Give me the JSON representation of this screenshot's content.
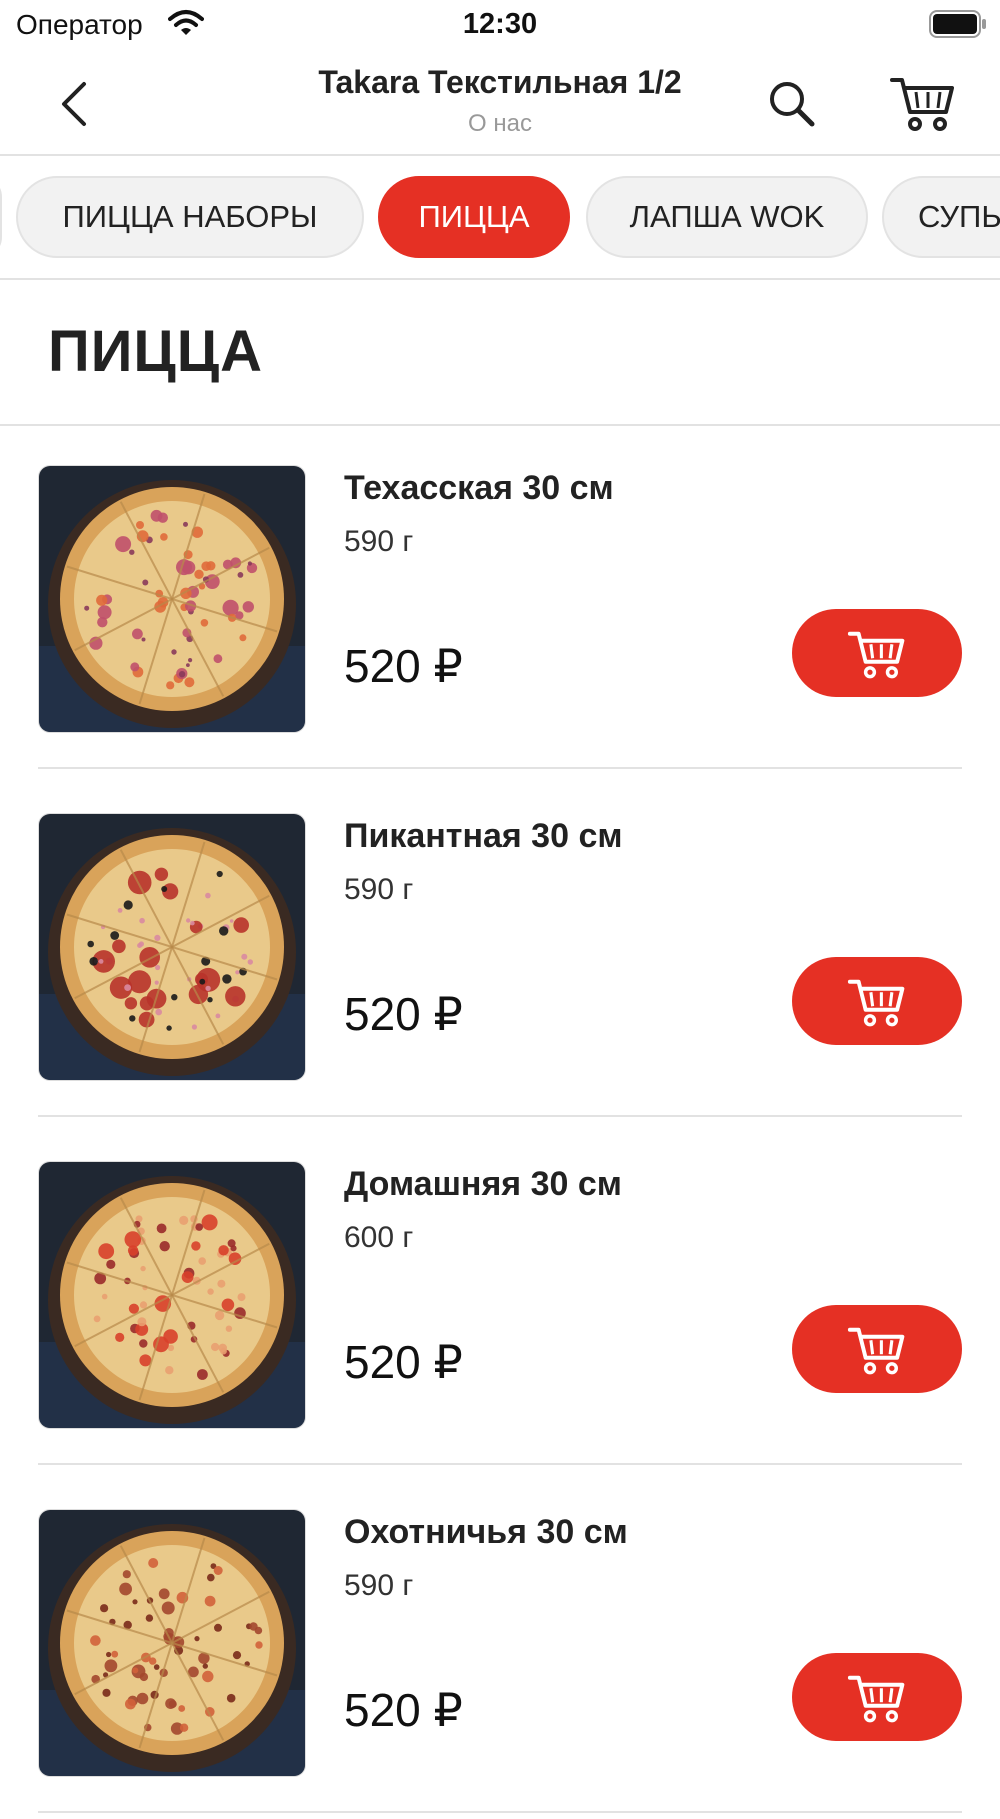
{
  "status_bar": {
    "carrier": "Оператор",
    "time": "12:30",
    "icons": [
      "wifi-icon",
      "battery-icon"
    ]
  },
  "nav": {
    "title": "Takara Текстильная 1/2",
    "subtitle": "О нас",
    "icons": [
      "back-arrow-icon",
      "search-icon",
      "cart-icon"
    ]
  },
  "categories": {
    "items": [
      {
        "label": "ПИЦЦА НАБОРЫ",
        "active": false
      },
      {
        "label": "ПИЦЦА",
        "active": true
      },
      {
        "label": "ЛАПША WOK",
        "active": false
      },
      {
        "label": "СУПЫ",
        "active": false
      }
    ]
  },
  "section": {
    "title": "ПИЦЦА"
  },
  "products": [
    {
      "name": "Техасская 30 см",
      "weight": "590 г",
      "price": "520 ₽",
      "toppings": "texas"
    },
    {
      "name": "Пикантная 30 см",
      "weight": "590 г",
      "price": "520 ₽",
      "toppings": "pepperoni"
    },
    {
      "name": "Домашняя 30 см",
      "weight": "600 г",
      "price": "520 ₽",
      "toppings": "home"
    },
    {
      "name": "Охотничья 30 см",
      "weight": "590 г",
      "price": "520 ₽",
      "toppings": "hunter"
    }
  ],
  "colors": {
    "accent": "#e53024",
    "chip_bg": "#f2f2f2",
    "divider": "#e2e2e2",
    "subtitle": "#999999"
  }
}
